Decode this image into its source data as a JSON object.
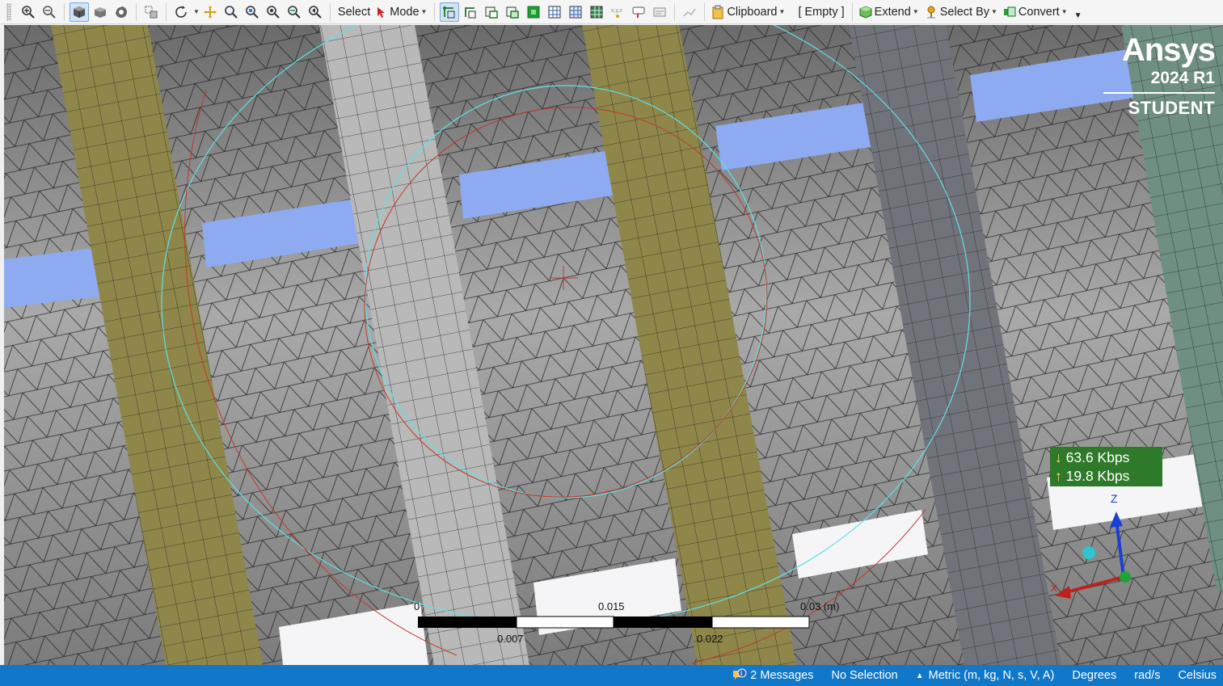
{
  "toolbar": {
    "select_label": "Select",
    "mode_label": "Mode",
    "clipboard_label": "Clipboard",
    "empty_label": "[ Empty ]",
    "extend_label": "Extend",
    "select_by_label": "Select By",
    "convert_label": "Convert"
  },
  "brand": {
    "name": "Ansys",
    "version": "2024 R1",
    "edition": "STUDENT"
  },
  "network": {
    "down": "63.6 Kbps",
    "up": "19.8 Kbps"
  },
  "scale": {
    "l0": "0",
    "l1": "0.015",
    "l2": "0.03 (m)",
    "l3": "0.007",
    "l4": "0.022"
  },
  "triad": {
    "z": "Z",
    "x": "X"
  },
  "status": {
    "messages": "2 Messages",
    "selection": "No Selection",
    "units": "Metric (m, kg, N, s, V, A)",
    "angle": "Degrees",
    "rate": "rad/s",
    "temp": "Celsius"
  },
  "colors": {
    "statusbar": "#1177c9",
    "strip_olive": "#8f8749",
    "strip_light": "#b9b9b9",
    "strip_dark": "#70737a",
    "strip_green": "#6f8f82",
    "gap_blue": "#8eaaf0"
  }
}
